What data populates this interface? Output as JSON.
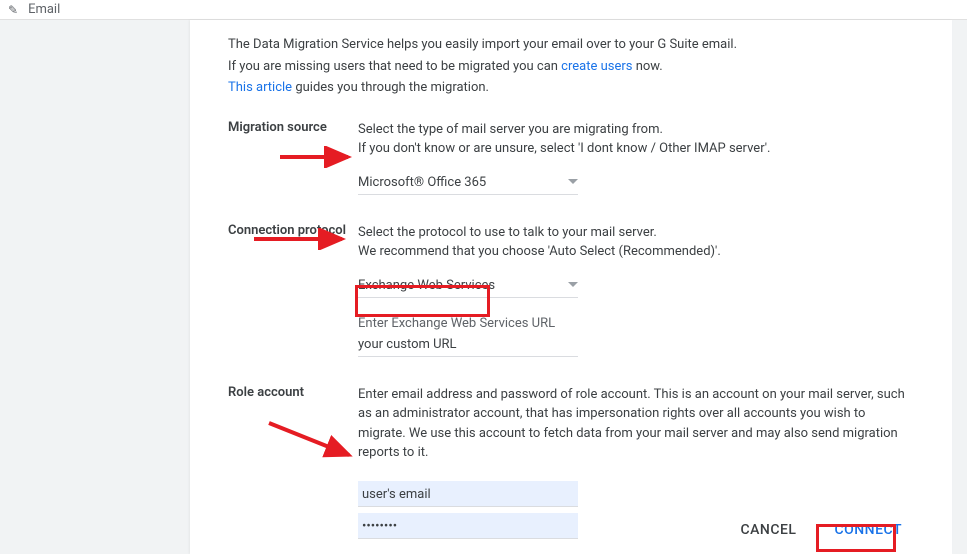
{
  "breadcrumb": {
    "icon": "pencil",
    "label": "Email"
  },
  "intro": {
    "line1_pre": "The Data Migration Service helps you easily import your email over to your G Suite email.",
    "line2_pre": "If you are missing users that need to be migrated you can ",
    "line2_link": "create users",
    "line2_post": " now.",
    "line3_link": "This article",
    "line3_post": " guides you through the migration."
  },
  "sections": {
    "migration_source": {
      "label": "Migration source",
      "help1": "Select the type of mail server you are migrating from.",
      "help2": "If you don't know or are unsure, select 'I dont know / Other IMAP server'.",
      "selected": "Microsoft® Office 365"
    },
    "connection_protocol": {
      "label": "Connection protocol",
      "help1": "Select the protocol to use to talk to your mail server.",
      "help2": "We recommend that you choose 'Auto Select (Recommended)'.",
      "selected": "Exchange Web Services",
      "url_label": "Enter Exchange Web Services URL",
      "url_value": "your custom URL"
    },
    "role_account": {
      "label": "Role account",
      "help": "Enter email address and password of role account. This is an account on your mail server, such as an administrator account, that has impersonation rights over all accounts you wish to migrate. We use this account to fetch data from your mail server and may also send migration reports to it.",
      "email_value": "user's email",
      "password_value": "••••••••"
    }
  },
  "buttons": {
    "cancel": "CANCEL",
    "connect": "CONNECT"
  },
  "annotations": {
    "arrow_color": "#e51c23",
    "box_color": "#e51c23"
  }
}
